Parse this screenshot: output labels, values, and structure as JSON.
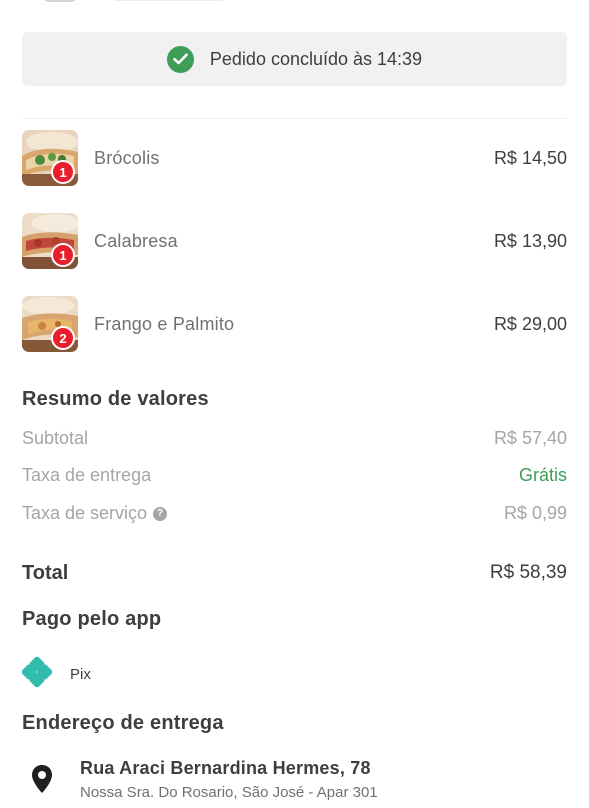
{
  "status": {
    "text": "Pedido concluído às 14:39",
    "icon": "check-circle-icon",
    "color": "#3e9d57"
  },
  "items": [
    {
      "quantity": "1",
      "name": "Brócolis",
      "price": "R$ 14,50"
    },
    {
      "quantity": "1",
      "name": "Calabresa",
      "price": "R$ 13,90"
    },
    {
      "quantity": "2",
      "name": "Frango e Palmito",
      "price": "R$ 29,00"
    }
  ],
  "summary": {
    "title": "Resumo de valores",
    "subtotal_label": "Subtotal",
    "subtotal_value": "R$ 57,40",
    "delivery_label": "Taxa de entrega",
    "delivery_value": "Grátis",
    "service_label": "Taxa de serviço",
    "service_value": "R$ 0,99",
    "total_label": "Total",
    "total_value": "R$ 58,39"
  },
  "payment": {
    "title": "Pago pelo app",
    "method": "Pix",
    "icon": "pix-icon",
    "color": "#32bcad"
  },
  "address": {
    "title": "Endereço de entrega",
    "line1": "Rua Araci Bernardina Hermes, 78",
    "line2": "Nossa Sra. Do Rosario, São José - Apar 301",
    "icon": "location-pin-icon"
  },
  "colors": {
    "badge": "#ea1d2c",
    "free": "#3e9d57",
    "text": "#3e3e3e",
    "muted": "#a6a5a5"
  }
}
